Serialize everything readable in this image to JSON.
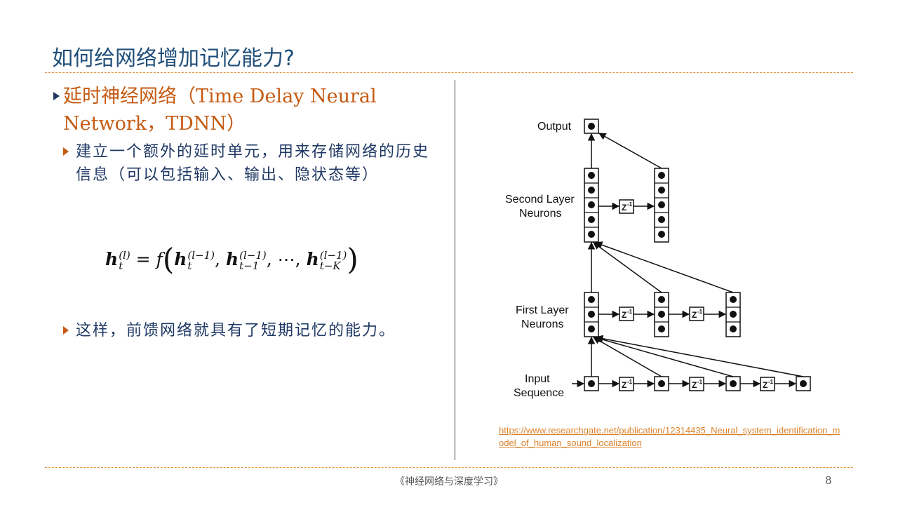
{
  "slide": {
    "title": "如何给网络增加记忆能力?",
    "bullet1": "延时神经网络（Time Delay Neural Network，TDNN）",
    "bullet2": "建立一个额外的延时单元，用来存储网络的历史信息（可以包括输入、输出、隐状态等）",
    "bullet3": "这样，前馈网络就具有了短期记忆的能力。",
    "formula": {
      "lhs_var": "h",
      "lhs_sub": "t",
      "lhs_sup": "(l)",
      "eq": "=",
      "func": "f",
      "t1_var": "h",
      "t1_sub": "t",
      "t1_sup": "(l−1)",
      "t2_var": "h",
      "t2_sub": "t−1",
      "t2_sup": "(l−1)",
      "dots": "⋯",
      "t3_var": "h",
      "t3_sub": "t−K",
      "t3_sup": "(l−1)"
    },
    "diagram": {
      "output_label": "Output",
      "second_label": "Second Layer Neurons",
      "second_label_l1": "Second Layer",
      "second_label_l2": "Neurons",
      "first_label_l1": "First Layer",
      "first_label_l2": "Neurons",
      "input_label_l1": "Input",
      "input_label_l2": "Sequence",
      "delay_label": "Z",
      "delay_sup": "-1"
    },
    "link": "https://www.researchgate.net/publication/12314435_Neural_system_identification_model_of_human_sound_localization",
    "footer": "《神经网络与深度学习》",
    "page_number": "8"
  }
}
